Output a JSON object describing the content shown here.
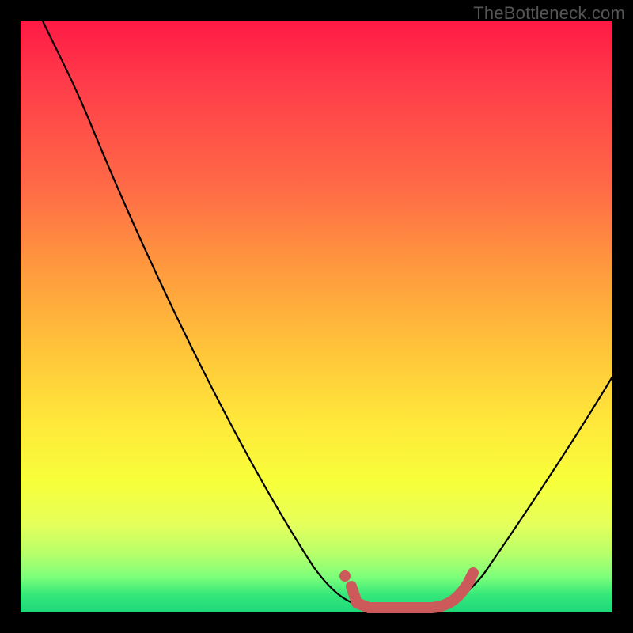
{
  "watermark": "TheBottleneck.com",
  "colors": {
    "background": "#000000",
    "gradient_top": "#ff1a44",
    "gradient_bottom": "#1dd87a",
    "curve_stroke": "#000000",
    "highlight_stroke": "#cc5a5a"
  },
  "chart_data": {
    "type": "line",
    "title": "",
    "xlabel": "",
    "ylabel": "",
    "xlim": [
      0,
      100
    ],
    "ylim": [
      0,
      100
    ],
    "grid": false,
    "legend": false,
    "series": [
      {
        "name": "bottleneck-curve",
        "x": [
          0,
          5,
          10,
          15,
          20,
          25,
          30,
          35,
          40,
          45,
          50,
          53,
          56,
          60,
          65,
          68,
          72,
          76,
          80,
          84,
          88,
          92,
          96,
          100
        ],
        "values": [
          108,
          100,
          91,
          82,
          73,
          64,
          55,
          46,
          37,
          28,
          19,
          13,
          8,
          3,
          1,
          0.5,
          0.5,
          2,
          5,
          10,
          16,
          23,
          31,
          40
        ]
      },
      {
        "name": "optimal-range-highlight",
        "x": [
          55,
          58,
          62,
          66,
          69,
          72,
          74,
          76
        ],
        "values": [
          4.5,
          2.5,
          1.2,
          0.8,
          0.9,
          1.5,
          3,
          5
        ]
      }
    ],
    "annotations": []
  }
}
